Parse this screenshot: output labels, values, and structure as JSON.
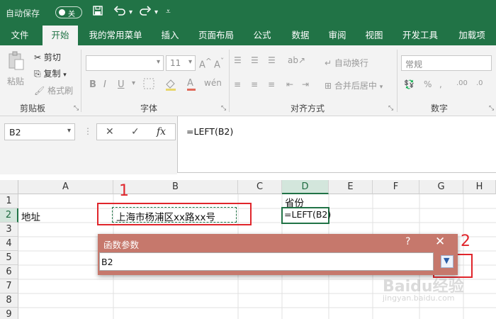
{
  "titlebar": {
    "autosave_label": "自动保存",
    "autosave_state": "关",
    "icons": [
      "save-icon",
      "undo-icon",
      "redo-icon",
      "customize-icon"
    ]
  },
  "ribbon_tabs": [
    "文件",
    "开始",
    "我的常用菜单",
    "插入",
    "页面布局",
    "公式",
    "数据",
    "审阅",
    "视图",
    "开发工具",
    "加载项"
  ],
  "ribbon_active_tab": "开始",
  "ribbon": {
    "clipboard": {
      "paste": "粘贴",
      "cut": "剪切",
      "copy": "复制",
      "format_painter": "格式刷",
      "label": "剪贴板"
    },
    "font": {
      "size": "11",
      "bold": "B",
      "italic": "I",
      "underline": "U",
      "label": "字体"
    },
    "alignment": {
      "wrap": "自动换行",
      "merge": "合并后居中",
      "label": "对齐方式"
    },
    "number": {
      "format": "常规",
      "label": "数字"
    }
  },
  "formula_bar": {
    "name_box": "B2",
    "cancel": "✕",
    "enter": "✓",
    "fx": "fx",
    "formula": "=LEFT(B2)"
  },
  "grid": {
    "columns": [
      "A",
      "B",
      "C",
      "D",
      "E",
      "F",
      "G",
      "H"
    ],
    "rows": [
      "1",
      "2",
      "3",
      "4",
      "5",
      "6",
      "7",
      "8",
      "9"
    ],
    "cells": {
      "D1": "省份",
      "A2": "地址",
      "B2": "上海市杨浦区xx路xx号",
      "D2": "=LEFT(B2)"
    }
  },
  "dialog": {
    "title": "函数参数",
    "help": "?",
    "close": "✕",
    "input_value": "B2"
  },
  "annotations": {
    "label1": "1",
    "label2": "2",
    "color": "#e0252b"
  },
  "watermark": {
    "line1": "Baidu经验",
    "line2": "jingyan.baidu.com"
  },
  "colors": {
    "excel_green": "#217346",
    "dialog_title": "#c6786c"
  }
}
